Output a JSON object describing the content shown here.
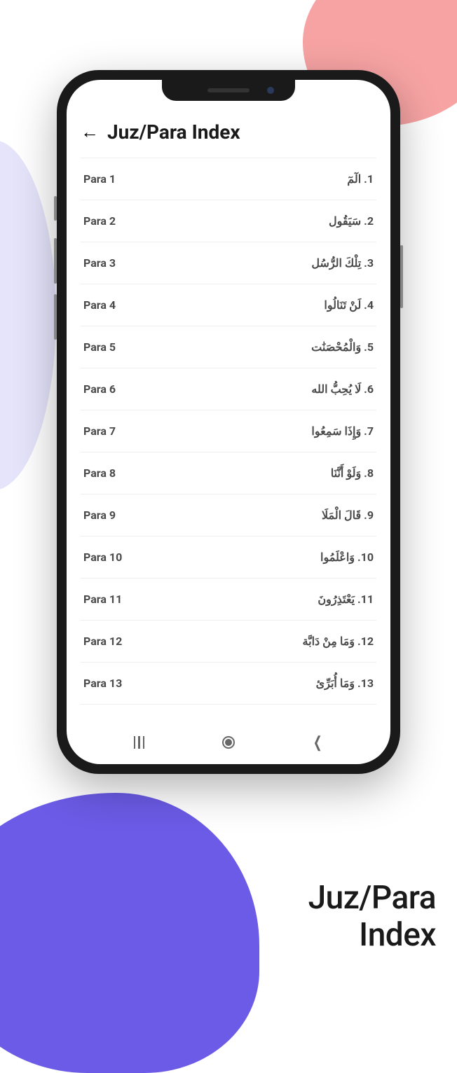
{
  "header": {
    "title": "Juz/Para Index"
  },
  "items": [
    {
      "left": "Para 1",
      "right": "1. الٓمٓ"
    },
    {
      "left": "Para 2",
      "right": "2. سَيَقُول"
    },
    {
      "left": "Para 3",
      "right": "3. تِلْكَ الرُّسُل"
    },
    {
      "left": "Para 4",
      "right": "4. لَنْ تَنَالُوا"
    },
    {
      "left": "Para 5",
      "right": "5. وَالْمُحْصَنَٰت"
    },
    {
      "left": "Para 6",
      "right": "6. لَا يُحِبُّ الله"
    },
    {
      "left": "Para 7",
      "right": "7. وَإِذَا سَمِعُوا"
    },
    {
      "left": "Para 8",
      "right": "8. وَلَوْ أَنَّنَا"
    },
    {
      "left": "Para 9",
      "right": "9. قَالَ الْمَلَا"
    },
    {
      "left": "Para 10",
      "right": "10. وَاعْلَمُوا"
    },
    {
      "left": "Para 11",
      "right": "11. يَعْتَذِرُونَ"
    },
    {
      "left": "Para 12",
      "right": "12. وَمَا مِنْ دَابَّة"
    },
    {
      "left": "Para 13",
      "right": "13. وَمَا أُبَرِّئ"
    }
  ],
  "caption": {
    "line1": "Juz/Para",
    "line2": "Index"
  }
}
